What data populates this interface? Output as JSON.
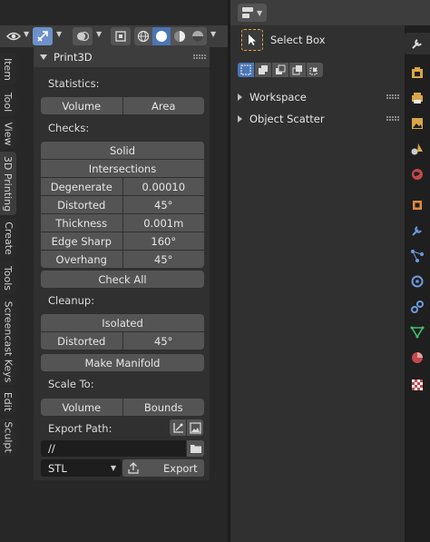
{
  "print3d": {
    "title": "Print3D",
    "statistics_label": "Statistics:",
    "volume_label": "Volume",
    "area_label": "Area",
    "checks_label": "Checks:",
    "solid_label": "Solid",
    "intersections_label": "Intersections",
    "checks": [
      {
        "label": "Degenerate",
        "value": "0.00010"
      },
      {
        "label": "Distorted",
        "value": "45°"
      },
      {
        "label": "Thickness",
        "value": "0.001m"
      },
      {
        "label": "Edge Sharp",
        "value": "160°"
      },
      {
        "label": "Overhang",
        "value": "45°"
      }
    ],
    "check_all_label": "Check All",
    "cleanup_label": "Cleanup:",
    "isolated_label": "Isolated",
    "distorted_label": "Distorted",
    "distorted_value": "45°",
    "make_manifold_label": "Make Manifold",
    "scale_to_label": "Scale To:",
    "scale_volume_label": "Volume",
    "scale_bounds_label": "Bounds",
    "export_path_label": "Export Path:",
    "export_path_value": "//",
    "format_value": "STL",
    "export_label": "Export"
  },
  "side_tabs": [
    "Item",
    "Tool",
    "View",
    "3D Printing",
    "Create",
    "Tools",
    "Screencast Keys",
    "Edit",
    "Sculpt"
  ],
  "active_side_tab": "3D Printing",
  "properties": {
    "tool_name": "Select Box",
    "workspace_label": "Workspace",
    "object_scatter_label": "Object Scatter"
  },
  "colors": {
    "accent": "#4a76b6",
    "orange": "#e3a33a"
  },
  "icons": [
    "eye-icon",
    "gizmo-icon",
    "overlay-icon",
    "xray-icon",
    "wireframe-icon",
    "solid-icon",
    "material-icon",
    "rendered-icon",
    "select-box-icon",
    "wrench-icon",
    "render-icon",
    "output-icon",
    "view-layer-icon",
    "scene-icon",
    "world-icon",
    "object-icon",
    "modifier-icon",
    "particles-icon",
    "physics-icon",
    "constraint-icon",
    "data-icon",
    "material-props-icon",
    "texture-icon",
    "folder-icon"
  ]
}
